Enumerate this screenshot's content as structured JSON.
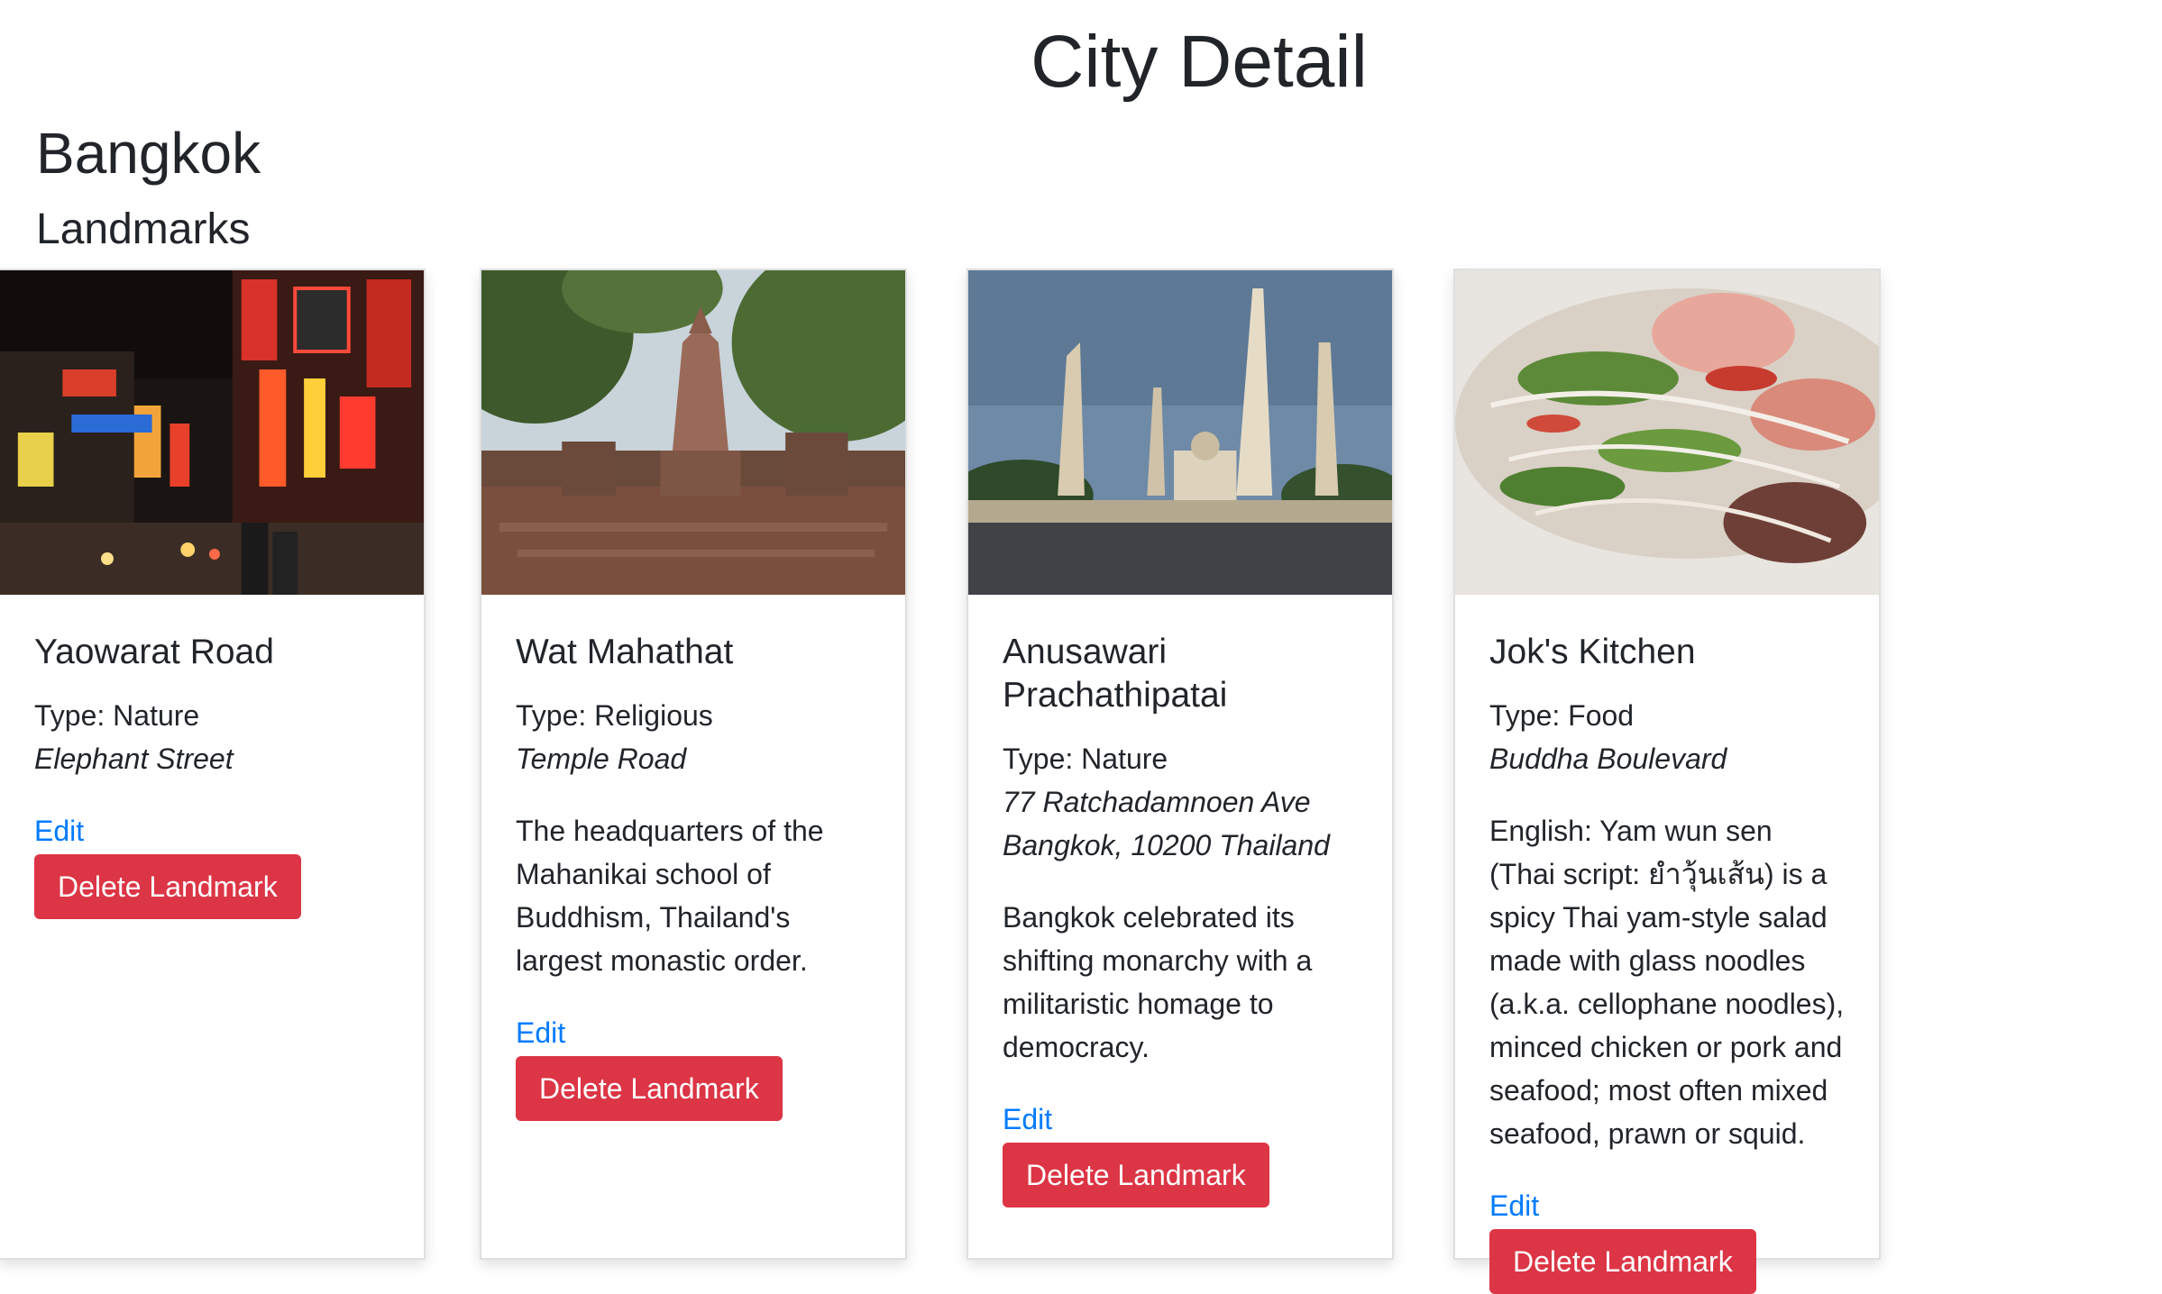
{
  "header": {
    "title": "City Detail"
  },
  "city": {
    "name": "Bangkok"
  },
  "landmarks_section": {
    "title": "Landmarks"
  },
  "landmarks": [
    {
      "name": "Yaowarat Road",
      "type": "Type: Nature",
      "address_lines": [
        "Elephant Street"
      ],
      "description": "",
      "edit_label": "Edit",
      "delete_label": "Delete Landmark",
      "image": "chinatown-neon-street-photo"
    },
    {
      "name": "Wat Mahathat",
      "type": "Type: Religious",
      "address_lines": [
        "Temple Road"
      ],
      "description": "The headquarters of the Mahanikai school of Buddhism, Thailand's largest monastic order.",
      "edit_label": "Edit",
      "delete_label": "Delete Landmark",
      "image": "temple-ruins-photo"
    },
    {
      "name": "Anusawari Prachathipatai",
      "type": "Type: Nature",
      "address_lines": [
        "77 Ratchadamnoen Ave",
        "Bangkok, 10200 Thailand"
      ],
      "description": "Bangkok celebrated its shifting monarchy with a militaristic homage to democracy.",
      "edit_label": "Edit",
      "delete_label": "Delete Landmark",
      "image": "democracy-monument-photo"
    },
    {
      "name": "Jok's Kitchen",
      "type": "Type: Food",
      "address_lines": [
        "Buddha Boulevard"
      ],
      "description": "English: Yam wun sen (Thai script: ยำวุ้นเส้น) is a spicy Thai yam-style salad made with glass noodles (a.k.a. cellophane noodles), minced chicken or pork and seafood; most often mixed seafood, prawn or squid.",
      "edit_label": "Edit",
      "delete_label": "Delete Landmark",
      "image": "glass-noodle-salad-photo"
    }
  ],
  "colors": {
    "text": "#212529",
    "link": "#007bff",
    "danger": "#dc3545"
  }
}
